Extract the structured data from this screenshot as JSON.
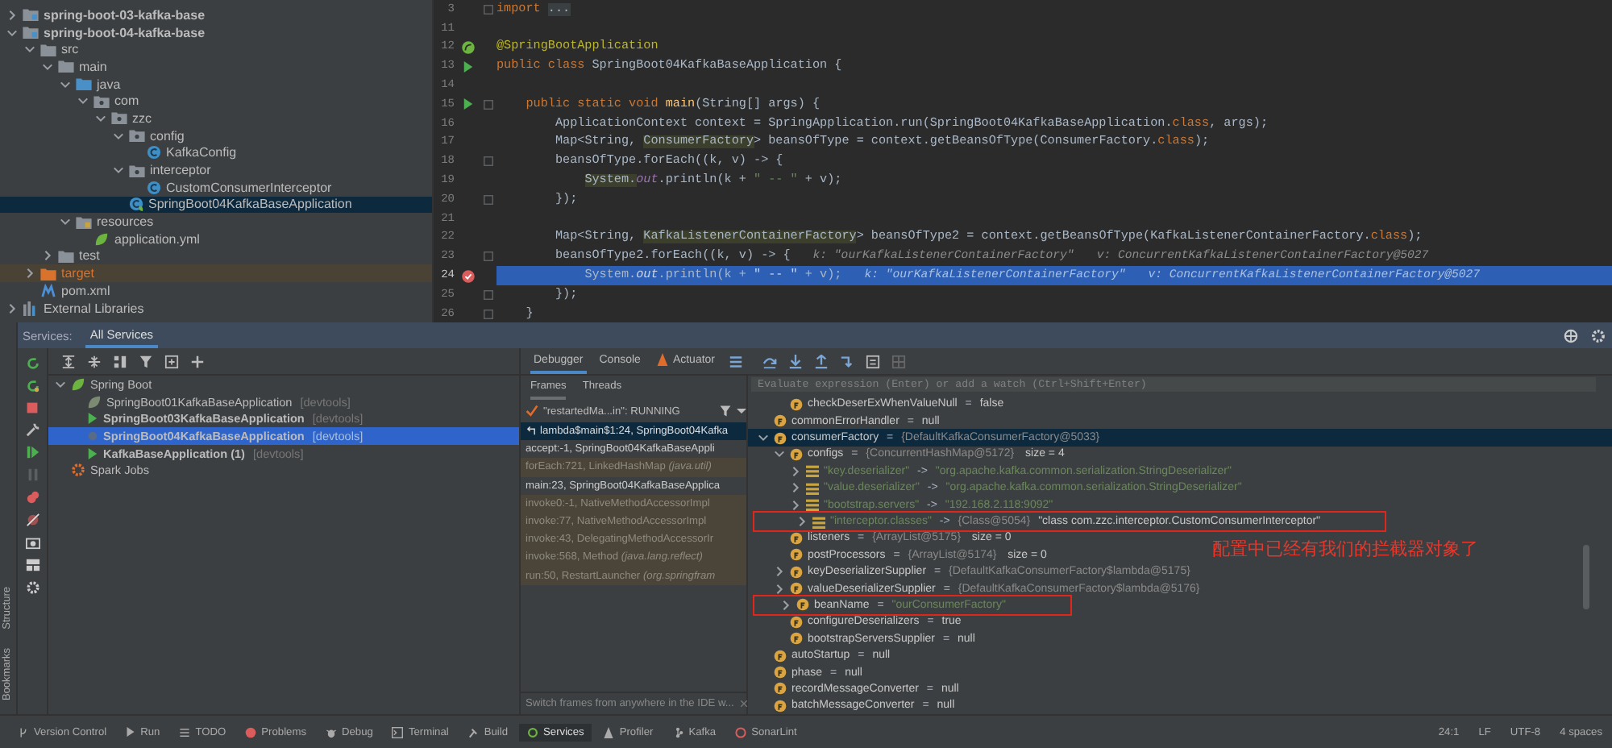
{
  "project_tree": [
    {
      "label": "spring-boot-03-kafka-base",
      "kind": "module",
      "expanded": false,
      "selected": false
    },
    {
      "label": "spring-boot-04-kafka-base",
      "kind": "module",
      "expanded": true,
      "selected": false,
      "children": [
        {
          "label": "src",
          "kind": "folder",
          "expanded": true,
          "selected": false,
          "children": [
            {
              "label": "main",
              "kind": "folder",
              "expanded": true,
              "selected": false,
              "children": [
                {
                  "label": "java",
                  "kind": "source-folder",
                  "expanded": true,
                  "selected": false,
                  "children": [
                    {
                      "label": "com",
                      "kind": "package",
                      "expanded": true,
                      "selected": false,
                      "children": [
                        {
                          "label": "zzc",
                          "kind": "package",
                          "expanded": true,
                          "selected": false,
                          "children": [
                            {
                              "label": "config",
                              "kind": "package",
                              "expanded": true,
                              "selected": false,
                              "children": [
                                {
                                  "label": "KafkaConfig",
                                  "kind": "class",
                                  "selected": false
                                }
                              ]
                            },
                            {
                              "label": "interceptor",
                              "kind": "package",
                              "expanded": true,
                              "selected": false,
                              "children": [
                                {
                                  "label": "CustomConsumerInterceptor",
                                  "kind": "class",
                                  "selected": false
                                }
                              ]
                            },
                            {
                              "label": "SpringBoot04KafkaBaseApplication",
                              "kind": "spring-class",
                              "selected": true
                            }
                          ]
                        }
                      ]
                    }
                  ]
                },
                {
                  "label": "resources",
                  "kind": "resources-folder",
                  "expanded": true,
                  "selected": false,
                  "children": [
                    {
                      "label": "application.yml",
                      "kind": "yaml",
                      "selected": false
                    }
                  ]
                }
              ]
            },
            {
              "label": "test",
              "kind": "folder",
              "expanded": false,
              "selected": false
            }
          ]
        },
        {
          "label": "target",
          "kind": "excluded-folder",
          "expanded": false,
          "selected": false
        },
        {
          "label": "pom.xml",
          "kind": "maven",
          "selected": false
        }
      ]
    },
    {
      "label": "External Libraries",
      "kind": "libraries",
      "expanded": false,
      "selected": false
    }
  ],
  "editor": {
    "lines": [
      {
        "number": "3",
        "kind": "plain",
        "fold": true,
        "execution_point": false,
        "tokens": [
          {
            "text": "import ",
            "kind": "kw"
          },
          {
            "text": "...",
            "kind": "folded"
          }
        ]
      },
      {
        "number": "11",
        "kind": "plain",
        "fold": false,
        "execution_point": false
      },
      {
        "number": "12",
        "kind": "bean",
        "fold": false,
        "execution_point": false,
        "tokens": [
          {
            "text": "@SpringBootApplication",
            "kind": "ann"
          }
        ]
      },
      {
        "number": "13",
        "kind": "run",
        "fold": false,
        "execution_point": false,
        "tokens": [
          {
            "text": "public class ",
            "kind": "kw"
          },
          {
            "text": "SpringBoot04KafkaBaseApplication {",
            "kind": "plain"
          }
        ]
      },
      {
        "number": "14",
        "kind": "plain",
        "fold": false,
        "execution_point": false
      },
      {
        "number": "15",
        "kind": "run",
        "fold": true,
        "execution_point": false,
        "tokens": [
          {
            "text": "    public static void ",
            "kind": "kw"
          },
          {
            "text": "main",
            "kind": "method"
          },
          {
            "text": "(String[] args) {",
            "kind": "plain"
          }
        ]
      },
      {
        "number": "16",
        "kind": "plain",
        "fold": false,
        "execution_point": false,
        "tokens": [
          {
            "text": "        ApplicationContext context = SpringApplication.run(SpringBoot04KafkaBaseApplication.",
            "kind": "plain"
          },
          {
            "text": "class",
            "kind": "kw"
          },
          {
            "text": ", args);",
            "kind": "plain"
          }
        ]
      },
      {
        "number": "17",
        "kind": "plain",
        "fold": false,
        "execution_point": false,
        "tokens": [
          {
            "text": "        Map<String, ",
            "kind": "plain"
          },
          {
            "text": "ConsumerFactory",
            "kind": "marked"
          },
          {
            "text": "> beansOfType = context.getBeansOfType(ConsumerFactory.",
            "kind": "plain"
          },
          {
            "text": "class",
            "kind": "kw"
          },
          {
            "text": ");",
            "kind": "plain"
          }
        ]
      },
      {
        "number": "18",
        "kind": "plain",
        "fold": true,
        "execution_point": false,
        "tokens": [
          {
            "text": "        beansOfType.forEach((k, v) -> {",
            "kind": "plain"
          }
        ]
      },
      {
        "number": "19",
        "kind": "plain",
        "fold": false,
        "execution_point": false,
        "tokens": [
          {
            "text": "            System.",
            "kind": "marked"
          },
          {
            "text": "out",
            "kind": "field"
          },
          {
            "text": ".println(k + ",
            "kind": "plain"
          },
          {
            "text": "\" -- \"",
            "kind": "str"
          },
          {
            "text": " + v);",
            "kind": "plain"
          }
        ]
      },
      {
        "number": "20",
        "kind": "plain",
        "fold": true,
        "execution_point": false,
        "tokens": [
          {
            "text": "        });",
            "kind": "plain"
          }
        ]
      },
      {
        "number": "21",
        "kind": "plain",
        "fold": false,
        "execution_point": false
      },
      {
        "number": "22",
        "kind": "plain",
        "fold": false,
        "execution_point": false,
        "tokens": [
          {
            "text": "        Map<String, ",
            "kind": "plain"
          },
          {
            "text": "KafkaListenerContainerFactory",
            "kind": "marked"
          },
          {
            "text": "> beansOfType2 = context.getBeansOfType(KafkaListenerContainerFactory.",
            "kind": "plain"
          },
          {
            "text": "class",
            "kind": "kw"
          },
          {
            "text": ");",
            "kind": "plain"
          }
        ]
      },
      {
        "number": "23",
        "kind": "plain",
        "fold": true,
        "execution_point": false,
        "tokens": [
          {
            "text": "        beansOfType2.forEach((k, v) -> {",
            "kind": "plain"
          }
        ],
        "hint": [
          "k: \"ourKafkaListenerContainerFactory\"",
          "v: ConcurrentKafkaListenerContainerFactory@5027"
        ]
      },
      {
        "number": "24",
        "kind": "breakpoint",
        "fold": false,
        "execution_point": true,
        "tokens": [
          {
            "text": "            System.",
            "kind": "plain"
          },
          {
            "text": "out",
            "kind": "field"
          },
          {
            "text": ".println(k + ",
            "kind": "plain"
          },
          {
            "text": "\" -- \"",
            "kind": "str"
          },
          {
            "text": " + v);",
            "kind": "plain"
          }
        ],
        "hint": [
          "k: \"ourKafkaListenerContainerFactory\"",
          "v: ConcurrentKafkaListenerContainerFactory@5027"
        ]
      },
      {
        "number": "25",
        "kind": "plain",
        "fold": true,
        "execution_point": false,
        "tokens": [
          {
            "text": "        });",
            "kind": "plain"
          }
        ]
      },
      {
        "number": "26",
        "kind": "plain",
        "fold": true,
        "execution_point": false,
        "tokens": [
          {
            "text": "    }",
            "kind": "plain"
          }
        ]
      }
    ]
  },
  "side_strip": [
    "Structure",
    "Bookmarks"
  ],
  "services": {
    "title": "Services:",
    "tabs": [
      {
        "label": "All Services",
        "selected": true
      }
    ],
    "tree": [
      {
        "label": "Spring Boot",
        "kind": "group",
        "expanded": true,
        "selected": false,
        "children": [
          {
            "label": "SpringBoot01KafkaBaseApplication",
            "tag": "[devtools]",
            "kind": "stopped",
            "selected": false
          },
          {
            "label": "SpringBoot03KafkaBaseApplication",
            "tag": "[devtools]",
            "kind": "running",
            "selected": false
          },
          {
            "label": "SpringBoot04KafkaBaseApplication",
            "tag": "[devtools]",
            "kind": "debugging",
            "selected": true
          },
          {
            "label": "KafkaBaseApplication (1)",
            "tag": "[devtools]",
            "kind": "running",
            "selected": false
          }
        ]
      },
      {
        "label": "Spark Jobs",
        "kind": "spark",
        "selected": false
      }
    ]
  },
  "debugger": {
    "tabs": [
      {
        "label": "Debugger",
        "selected": true
      },
      {
        "label": "Console",
        "selected": false
      },
      {
        "label": "Actuator",
        "selected": false
      }
    ],
    "frame_tabs": [
      {
        "label": "Frames",
        "selected": true
      },
      {
        "label": "Threads",
        "selected": false
      }
    ],
    "thread": "\"restartedMa...in\": RUNNING",
    "frames": [
      {
        "text": "lambda$main$1:24, SpringBoot04Kafka",
        "kind": "current",
        "selected": true
      },
      {
        "text": "accept:-1, SpringBoot04KafkaBaseAppli",
        "kind": "user",
        "selected": false
      },
      {
        "text": "forEach:721, LinkedHashMap *(java.util)*",
        "kind": "library",
        "selected": false
      },
      {
        "text": "main:23, SpringBoot04KafkaBaseApplica",
        "kind": "user",
        "selected": false
      },
      {
        "text": "invoke0:-1, NativeMethodAccessorImpl",
        "kind": "library",
        "selected": false
      },
      {
        "text": "invoke:77, NativeMethodAccessorImpl",
        "kind": "library",
        "selected": false
      },
      {
        "text": "invoke:43, DelegatingMethodAccessorIr",
        "kind": "library",
        "selected": false
      },
      {
        "text": "invoke:568, Method *(java.lang.reflect)*",
        "kind": "library",
        "selected": false
      },
      {
        "text": "run:50, RestartLauncher *(org.springfram*",
        "kind": "library",
        "selected": false
      }
    ],
    "frames_hint": "Switch frames from anywhere in the IDE w...",
    "evaluate": {
      "placeholder": "Evaluate expression (Enter) or add a watch (Ctrl+Shift+Enter)"
    },
    "variables_continued": [
      {
        "name": "checkDeserExWhenValueNull",
        "kind": "field",
        "selected": false,
        "boxed": false,
        "value": [
          {
            "text": " = ",
            "kind": "op"
          },
          {
            "text": "false",
            "kind": "plain"
          }
        ]
      }
    ],
    "variables": [
      {
        "name": "commonErrorHandler",
        "kind": "field",
        "selected": false,
        "boxed": false,
        "value": [
          {
            "text": " = ",
            "kind": "op"
          },
          {
            "text": "null",
            "kind": "plain"
          }
        ]
      },
      {
        "name": "consumerFactory",
        "kind": "field",
        "expanded": true,
        "selected": true,
        "boxed": false,
        "value": [
          {
            "text": " = ",
            "kind": "op"
          },
          {
            "text": "{DefaultKafkaConsumerFactory@5033}",
            "kind": "ref"
          }
        ],
        "children": [
          {
            "name": "configs",
            "kind": "field",
            "expanded": true,
            "selected": false,
            "boxed": false,
            "value": [
              {
                "text": " = ",
                "kind": "op"
              },
              {
                "text": "{ConcurrentHashMap@5172}",
                "kind": "ref"
              },
              {
                "text": "  size = 4",
                "kind": "plain"
              }
            ],
            "children": [
              {
                "name": "\"key.deserializer\"",
                "kind": "entry",
                "expanded": false,
                "selected": false,
                "boxed": false,
                "value": [
                  {
                    "text": " -> ",
                    "kind": "op"
                  },
                  {
                    "text": "\"org.apache.kafka.common.serialization.StringDeserializer\"",
                    "kind": "str"
                  }
                ]
              },
              {
                "name": "\"value.deserializer\"",
                "kind": "entry",
                "expanded": false,
                "selected": false,
                "boxed": false,
                "value": [
                  {
                    "text": " -> ",
                    "kind": "op"
                  },
                  {
                    "text": "\"org.apache.kafka.common.serialization.StringDeserializer\"",
                    "kind": "str"
                  }
                ]
              },
              {
                "name": "\"bootstrap.servers\"",
                "kind": "entry",
                "expanded": false,
                "selected": false,
                "boxed": false,
                "value": [
                  {
                    "text": " -> ",
                    "kind": "op"
                  },
                  {
                    "text": "\"192.168.2.118:9092\"",
                    "kind": "str"
                  }
                ]
              },
              {
                "name": "\"interceptor.classes\"",
                "kind": "entry",
                "expanded": false,
                "selected": false,
                "boxed": true,
                "value": [
                  {
                    "text": " -> ",
                    "kind": "op"
                  },
                  {
                    "text": "{Class@5054}",
                    "kind": "ref"
                  },
                  {
                    "text": " \"class com.zzc.interceptor.CustomConsumerInterceptor\"",
                    "kind": "plain"
                  }
                ]
              }
            ]
          },
          {
            "name": "listeners",
            "kind": "field",
            "selected": false,
            "boxed": false,
            "value": [
              {
                "text": " = ",
                "kind": "op"
              },
              {
                "text": "{ArrayList@5175}",
                "kind": "ref"
              },
              {
                "text": "  size = 0",
                "kind": "plain"
              }
            ]
          },
          {
            "name": "postProcessors",
            "kind": "field",
            "selected": false,
            "boxed": false,
            "value": [
              {
                "text": " = ",
                "kind": "op"
              },
              {
                "text": "{ArrayList@5174}",
                "kind": "ref"
              },
              {
                "text": "  size = 0",
                "kind": "plain"
              }
            ]
          },
          {
            "name": "keyDeserializerSupplier",
            "kind": "field",
            "expanded": false,
            "selected": false,
            "boxed": false,
            "value": [
              {
                "text": " = ",
                "kind": "op"
              },
              {
                "text": "{DefaultKafkaConsumerFactory$lambda@5175}",
                "kind": "ref"
              }
            ]
          },
          {
            "name": "valueDeserializerSupplier",
            "kind": "field",
            "expanded": false,
            "selected": false,
            "boxed": false,
            "value": [
              {
                "text": " = ",
                "kind": "op"
              },
              {
                "text": "{DefaultKafkaConsumerFactory$lambda@5176}",
                "kind": "ref"
              }
            ]
          },
          {
            "name": "beanName",
            "kind": "field",
            "expanded": false,
            "selected": false,
            "boxed": true,
            "value": [
              {
                "text": " = ",
                "kind": "op"
              },
              {
                "text": "\"ourConsumerFactory\"",
                "kind": "str"
              }
            ]
          },
          {
            "name": "configureDeserializers",
            "kind": "field",
            "selected": false,
            "boxed": false,
            "value": [
              {
                "text": " = ",
                "kind": "op"
              },
              {
                "text": "true",
                "kind": "plain"
              }
            ]
          },
          {
            "name": "bootstrapServersSupplier",
            "kind": "field",
            "selected": false,
            "boxed": false,
            "value": [
              {
                "text": " = ",
                "kind": "op"
              },
              {
                "text": "null",
                "kind": "plain"
              }
            ]
          }
        ]
      },
      {
        "name": "autoStartup",
        "kind": "field",
        "selected": false,
        "boxed": false,
        "value": [
          {
            "text": " = ",
            "kind": "op"
          },
          {
            "text": "null",
            "kind": "plain"
          }
        ]
      },
      {
        "name": "phase",
        "kind": "field",
        "selected": false,
        "boxed": false,
        "value": [
          {
            "text": " = ",
            "kind": "op"
          },
          {
            "text": "null",
            "kind": "plain"
          }
        ]
      },
      {
        "name": "recordMessageConverter",
        "kind": "field",
        "selected": false,
        "boxed": false,
        "value": [
          {
            "text": " = ",
            "kind": "op"
          },
          {
            "text": "null",
            "kind": "plain"
          }
        ]
      },
      {
        "name": "batchMessageConverter",
        "kind": "field",
        "selected": false,
        "boxed": false,
        "value": [
          {
            "text": " = ",
            "kind": "op"
          },
          {
            "text": "null",
            "kind": "plain"
          }
        ]
      }
    ],
    "annotation": "配置中已经有我们的拦截器对象了"
  },
  "bottom_tools": [
    {
      "label": "Version Control",
      "selected": false
    },
    {
      "label": "Run",
      "selected": false
    },
    {
      "label": "TODO",
      "selected": false
    },
    {
      "label": "Problems",
      "selected": false
    },
    {
      "label": "Debug",
      "selected": false
    },
    {
      "label": "Terminal",
      "selected": false
    },
    {
      "label": "Build",
      "selected": false
    },
    {
      "label": "Services",
      "selected": true
    },
    {
      "label": "Profiler",
      "selected": false
    },
    {
      "label": "Kafka",
      "selected": false
    },
    {
      "label": "SonarLint",
      "selected": false
    }
  ],
  "status_bar": [
    "24:1",
    "LF",
    "UTF-8",
    "4 spaces"
  ]
}
